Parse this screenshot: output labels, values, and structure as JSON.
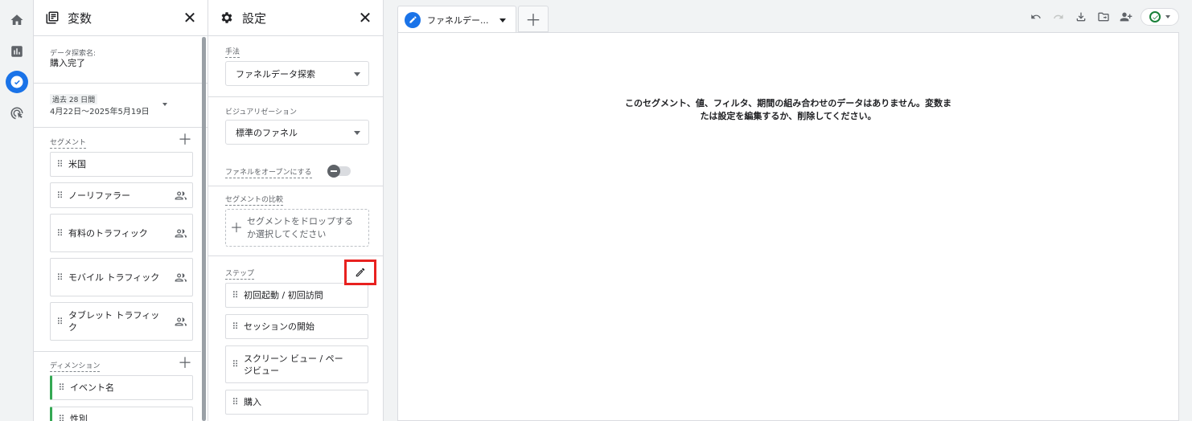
{
  "rail": {
    "items": [
      "home-icon",
      "reports-icon",
      "explore-icon",
      "advertising-icon"
    ],
    "active_index": 2
  },
  "variables_panel": {
    "title": "変数",
    "exploration_name_label": "データ探索名:",
    "exploration_name": "購入完了",
    "date_range_label": "過去 28 日間",
    "date_range": "4月22日〜2025年5月19日",
    "segments_label": "セグメント",
    "segments": [
      {
        "label": "米国",
        "has_people_icon": false
      },
      {
        "label": "ノーリファラー",
        "has_people_icon": true
      },
      {
        "label": "有料のトラフィック",
        "has_people_icon": true
      },
      {
        "label": "モバイル トラフィック",
        "has_people_icon": true
      },
      {
        "label": "タブレット トラフィック",
        "has_people_icon": true
      }
    ],
    "dimensions_label": "ディメンション",
    "dimensions": [
      "イベント名",
      "性別"
    ]
  },
  "settings_panel": {
    "title": "設定",
    "technique_label": "手法",
    "technique_value": "ファネルデータ探索",
    "visualization_label": "ビジュアリゼーション",
    "visualization_value": "標準のファネル",
    "open_funnel_label": "ファネルをオープンにする",
    "open_funnel_on": false,
    "segment_compare_label": "セグメントの比較",
    "segment_drop_text": "セグメントをドロップするか選択してください",
    "steps_label": "ステップ",
    "steps": [
      "初回起動 / 初回訪問",
      "セッションの開始",
      "スクリーン ビュー / ページビュー",
      "購入"
    ]
  },
  "main": {
    "tab_label": "ファネルデー...",
    "empty_message": "このセグメント、値、フィルタ、期間の組み合わせのデータはありません。変数または設定を編集するか、削除してください。",
    "toolbar_icons": [
      "undo-icon",
      "redo-icon",
      "download-icon",
      "share-icon",
      "add-user-icon"
    ],
    "status": "ok"
  },
  "colors": {
    "accent": "#1a73e8",
    "highlight": "#e8211f",
    "dimension_border": "#34a853",
    "status_ok": "#188038"
  }
}
